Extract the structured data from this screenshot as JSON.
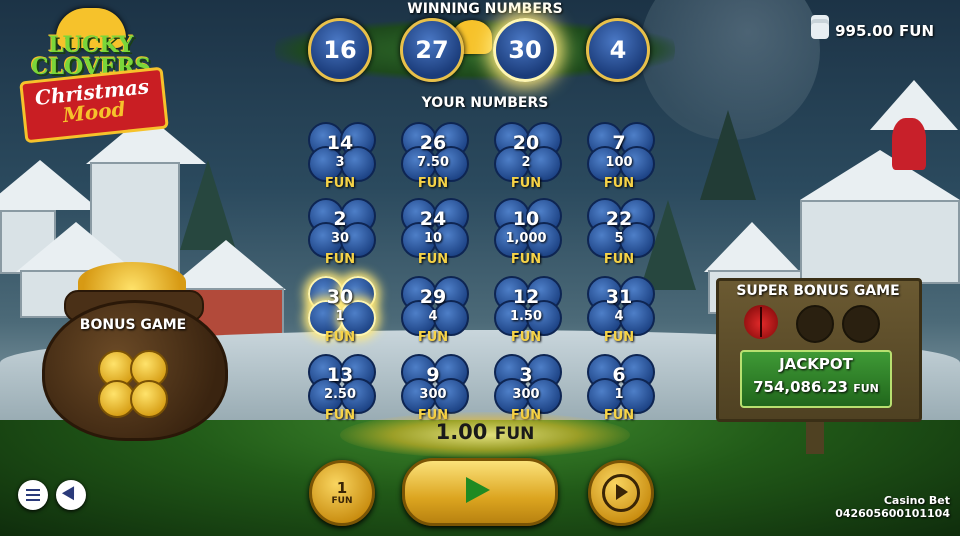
{
  "logo": {
    "line1": "LUCKY CLOVERS",
    "line2": "Christmas",
    "line3": "Mood"
  },
  "winning_numbers": {
    "title": "WINNING NUMBERS",
    "balls": [
      {
        "value": "16",
        "highlighted": false
      },
      {
        "value": "27",
        "highlighted": false
      },
      {
        "value": "30",
        "highlighted": true
      },
      {
        "value": "4",
        "highlighted": false
      }
    ]
  },
  "your_numbers": {
    "title": "YOUR NUMBERS",
    "currency": "FUN",
    "cells": [
      {
        "number": "14",
        "prize": "3",
        "hit": false
      },
      {
        "number": "26",
        "prize": "7.50",
        "hit": false
      },
      {
        "number": "20",
        "prize": "2",
        "hit": false
      },
      {
        "number": "7",
        "prize": "100",
        "hit": false
      },
      {
        "number": "2",
        "prize": "30",
        "hit": false
      },
      {
        "number": "24",
        "prize": "10",
        "hit": false
      },
      {
        "number": "10",
        "prize": "1,000",
        "hit": false
      },
      {
        "number": "22",
        "prize": "5",
        "hit": false
      },
      {
        "number": "30",
        "prize": "1",
        "hit": true
      },
      {
        "number": "29",
        "prize": "4",
        "hit": false
      },
      {
        "number": "12",
        "prize": "1.50",
        "hit": false
      },
      {
        "number": "31",
        "prize": "4",
        "hit": false
      },
      {
        "number": "13",
        "prize": "2.50",
        "hit": false
      },
      {
        "number": "9",
        "prize": "300",
        "hit": false
      },
      {
        "number": "3",
        "prize": "300",
        "hit": false
      },
      {
        "number": "6",
        "prize": "1",
        "hit": false
      }
    ]
  },
  "balance": {
    "value": "995.00",
    "unit": "FUN",
    "icon": "coins-stack-icon"
  },
  "bonus_game": {
    "label": "BONUS GAME"
  },
  "super_bonus": {
    "title": "SUPER BONUS GAME",
    "jackpot_label": "JACKPOT",
    "jackpot_value": "754,086.23",
    "jackpot_unit": "FUN",
    "ladybugs_found": 1,
    "ladybugs_total": 3
  },
  "bet": {
    "value": "1.00",
    "unit": "FUN"
  },
  "controls": {
    "bet_button_value": "1",
    "bet_button_unit": "FUN",
    "play_icon": "play-icon",
    "autoplay_icon": "autoplay-icon",
    "menu_icon": "menu-icon",
    "nav_icon": "navigate-icon"
  },
  "footer": {
    "brand": "Casino Bet",
    "id": "042605600101104"
  },
  "colors": {
    "accent_gold": "#f6c22b",
    "ball_blue": "#1b3c7a",
    "jackpot_green": "#2f8a2a",
    "highlight": "#ffe97a"
  }
}
